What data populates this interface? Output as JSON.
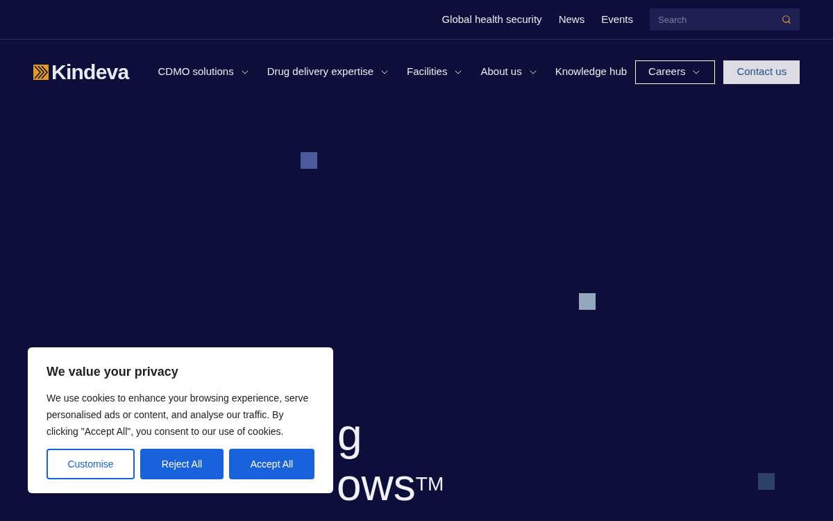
{
  "top_links": [
    "Global health security",
    "News",
    "Events"
  ],
  "search": {
    "placeholder": "Search"
  },
  "logo": {
    "text": "Kindeva"
  },
  "nav": [
    {
      "label": "CDMO solutions",
      "dropdown": true
    },
    {
      "label": "Drug delivery expertise",
      "dropdown": true
    },
    {
      "label": "Facilities",
      "dropdown": true
    },
    {
      "label": "About us",
      "dropdown": true
    },
    {
      "label": "Knowledge hub",
      "dropdown": false
    }
  ],
  "actions": [
    {
      "label": "Careers",
      "kind": "outline",
      "dropdown": true
    },
    {
      "label": "Contact us",
      "kind": "filled",
      "dropdown": false
    }
  ],
  "hero": {
    "lines": [
      "g",
      "ows$^{TM}$"
    ]
  },
  "cookie_dialog": {
    "title": "We value your privacy",
    "text": "We use cookies to enhance your browsing experience, serve personalised ads or content, and analyse our traffic. By clicking \"Accept All\", you consent to our use of cookies.",
    "buttons": [
      {
        "label": "Customise",
        "kind": "outline"
      },
      {
        "label": "Reject All",
        "kind": "filled"
      },
      {
        "label": "Accept All",
        "kind": "filled"
      }
    ]
  }
}
